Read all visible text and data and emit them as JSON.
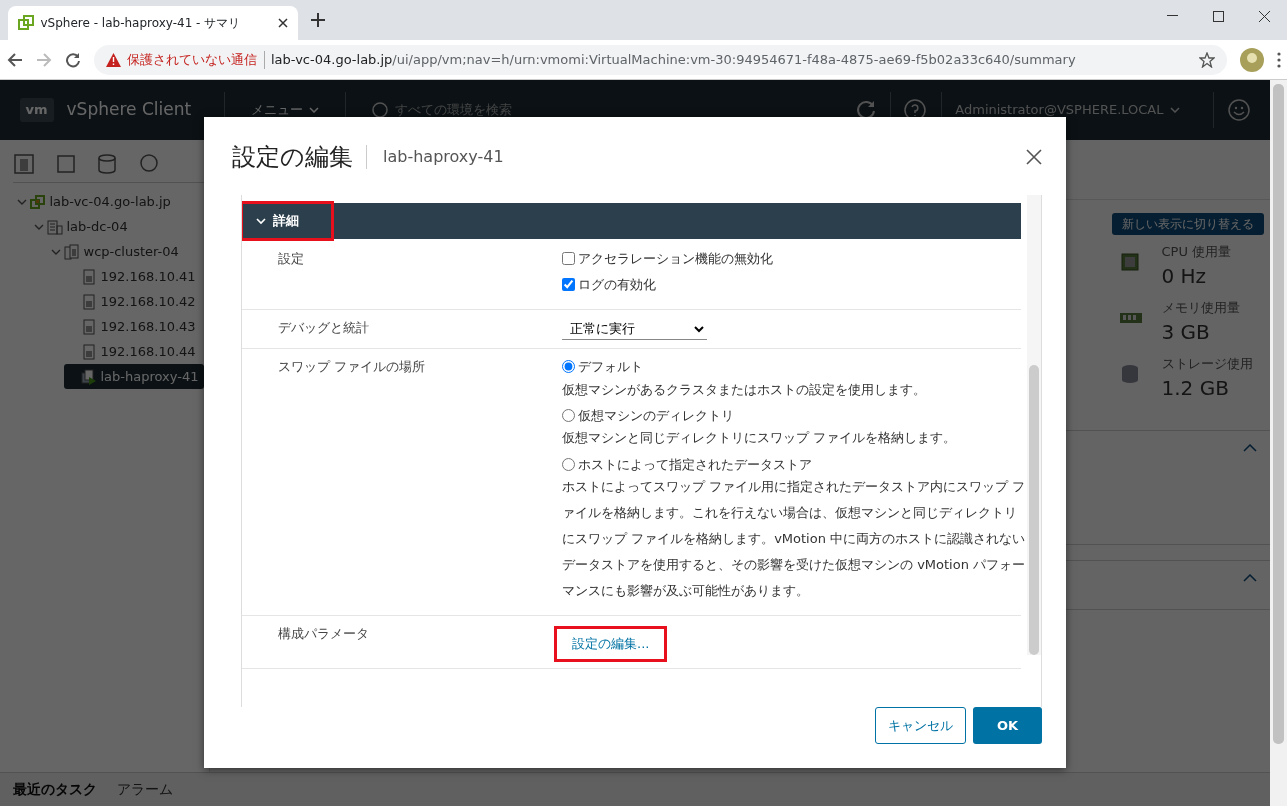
{
  "browser": {
    "tab_title": "vSphere - lab-haproxy-41 - サマリ",
    "security_warning": "保護されていない通信",
    "url_host": "lab-vc-04.go-lab.jp",
    "url_path": "/ui/app/vm;nav=h/urn:vmomi:VirtualMachine:vm-30:94954671-f48a-4875-ae69-f5b02a33c640/summary"
  },
  "header": {
    "logo": "vm",
    "product": "vSphere Client",
    "menu": "メニュー",
    "search_placeholder": "すべての環境を検索",
    "user": "Administrator@VSPHERE.LOCAL"
  },
  "sidebar": {
    "tree": [
      {
        "label": "lab-vc-04.go-lab.jp",
        "kind": "vcenter",
        "expanded": true,
        "selected": false,
        "children": [
          {
            "label": "lab-dc-04",
            "kind": "datacenter",
            "expanded": true,
            "selected": false,
            "children": [
              {
                "label": "wcp-cluster-04",
                "kind": "cluster",
                "expanded": true,
                "selected": false,
                "children": [
                  {
                    "label": "192.168.10.41",
                    "kind": "host",
                    "selected": false
                  },
                  {
                    "label": "192.168.10.42",
                    "kind": "host",
                    "selected": false
                  },
                  {
                    "label": "192.168.10.43",
                    "kind": "host",
                    "selected": false
                  },
                  {
                    "label": "192.168.10.44",
                    "kind": "host",
                    "selected": false
                  },
                  {
                    "label": "lab-haproxy-41",
                    "kind": "vm",
                    "selected": true
                  }
                ]
              }
            ]
          }
        ]
      }
    ]
  },
  "summary": {
    "switch_button": "新しい表示に切り替える",
    "metrics": [
      {
        "kind": "cpu",
        "label": "CPU 使用量",
        "value": "0 Hz"
      },
      {
        "kind": "memory",
        "label": "メモリ使用量",
        "value": "3 GB"
      },
      {
        "kind": "storage",
        "label": "ストレージ使用",
        "value": "1.2 GB"
      }
    ]
  },
  "bottom_tabs": [
    {
      "label": "最近のタスク",
      "selected": true
    },
    {
      "label": "アラーム",
      "selected": false
    }
  ],
  "dialog": {
    "title": "設定の編集",
    "subtitle": "lab-haproxy-41",
    "section": {
      "label": "詳細",
      "expanded": true,
      "highlighted": true
    },
    "rows": [
      {
        "kind": "checkboxes",
        "label": "設定",
        "options": [
          {
            "label": "アクセラレーション機能の無効化",
            "checked": false
          },
          {
            "label": "ログの有効化",
            "checked": true
          }
        ]
      },
      {
        "kind": "select",
        "label": "デバッグと統計",
        "value": "正常に実行"
      },
      {
        "kind": "radios",
        "label": "スワップ ファイルの場所",
        "options": [
          {
            "label": "デフォルト",
            "description": "仮想マシンがあるクラスタまたはホストの設定を使用します。",
            "selected": true
          },
          {
            "label": "仮想マシンのディレクトリ",
            "description": "仮想マシンと同じディレクトリにスワップ ファイルを格納します。",
            "selected": false
          },
          {
            "label": "ホストによって指定されたデータストア",
            "description": "ホストによってスワップ ファイル用に指定されたデータストア内にスワップ ファイルを格納します。これを行えない場合は、仮想マシンと同じディレクトリにスワップ ファイルを格納します。vMotion 中に両方のホストに認識されないデータストアを使用すると、その影響を受けた仮想マシンの vMotion パフォーマンスにも影響が及ぶ可能性があります。",
            "selected": false
          }
        ]
      },
      {
        "kind": "link",
        "label": "構成パラメータ",
        "value": "設定の編集...",
        "highlighted": true
      }
    ],
    "buttons": [
      {
        "label": "キャンセル",
        "kind": "secondary"
      },
      {
        "label": "OK",
        "kind": "primary"
      }
    ]
  }
}
